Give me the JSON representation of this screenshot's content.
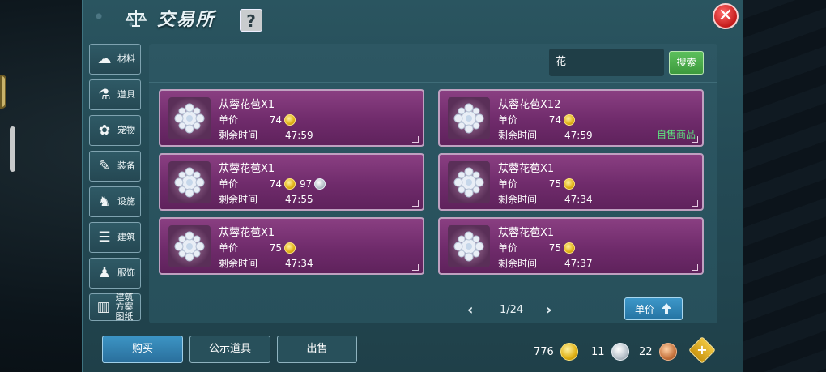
{
  "window": {
    "title": "交易所",
    "help_label": "?",
    "close_label": "✕"
  },
  "sidebar": {
    "items": [
      {
        "label": "材料",
        "icon": "materials-icon"
      },
      {
        "label": "道具",
        "icon": "props-icon"
      },
      {
        "label": "宠物",
        "icon": "pet-paw-icon"
      },
      {
        "label": "装备",
        "icon": "equipment-icon"
      },
      {
        "label": "设施",
        "icon": "facility-icon"
      },
      {
        "label": "建筑",
        "icon": "building-icon"
      },
      {
        "label": "服饰",
        "icon": "clothing-icon"
      },
      {
        "label": "建筑方案图纸",
        "icon": "blueprint-icon"
      }
    ]
  },
  "search": {
    "value": "花",
    "button_label": "搜索"
  },
  "labels": {
    "price": "单价",
    "time": "剩余时间"
  },
  "listings": [
    {
      "name": "苁蓉花苞X1",
      "price": "74",
      "silver": "",
      "time": "47:59",
      "tag": ""
    },
    {
      "name": "苁蓉花苞X12",
      "price": "74",
      "silver": "",
      "time": "47:59",
      "tag": "自售商品"
    },
    {
      "name": "苁蓉花苞X1",
      "price": "74",
      "silver": "97",
      "time": "47:55",
      "tag": ""
    },
    {
      "name": "苁蓉花苞X1",
      "price": "75",
      "silver": "",
      "time": "47:34",
      "tag": ""
    },
    {
      "name": "苁蓉花苞X1",
      "price": "75",
      "silver": "",
      "time": "47:34",
      "tag": ""
    },
    {
      "name": "苁蓉花苞X1",
      "price": "75",
      "silver": "",
      "time": "47:37",
      "tag": ""
    }
  ],
  "pager": {
    "prev": "‹",
    "next": "›",
    "text": "1/24"
  },
  "sort": {
    "label": "单价"
  },
  "actions": {
    "buy": "购买",
    "public": "公示道具",
    "sell": "出售"
  },
  "currencies": {
    "gold": "776",
    "silver": "11",
    "copper": "22"
  },
  "colors": {
    "card": "#7a347a",
    "accent_green": "#4caf50",
    "accent_blue": "#2f86b8",
    "close_red": "#d42a2a"
  }
}
